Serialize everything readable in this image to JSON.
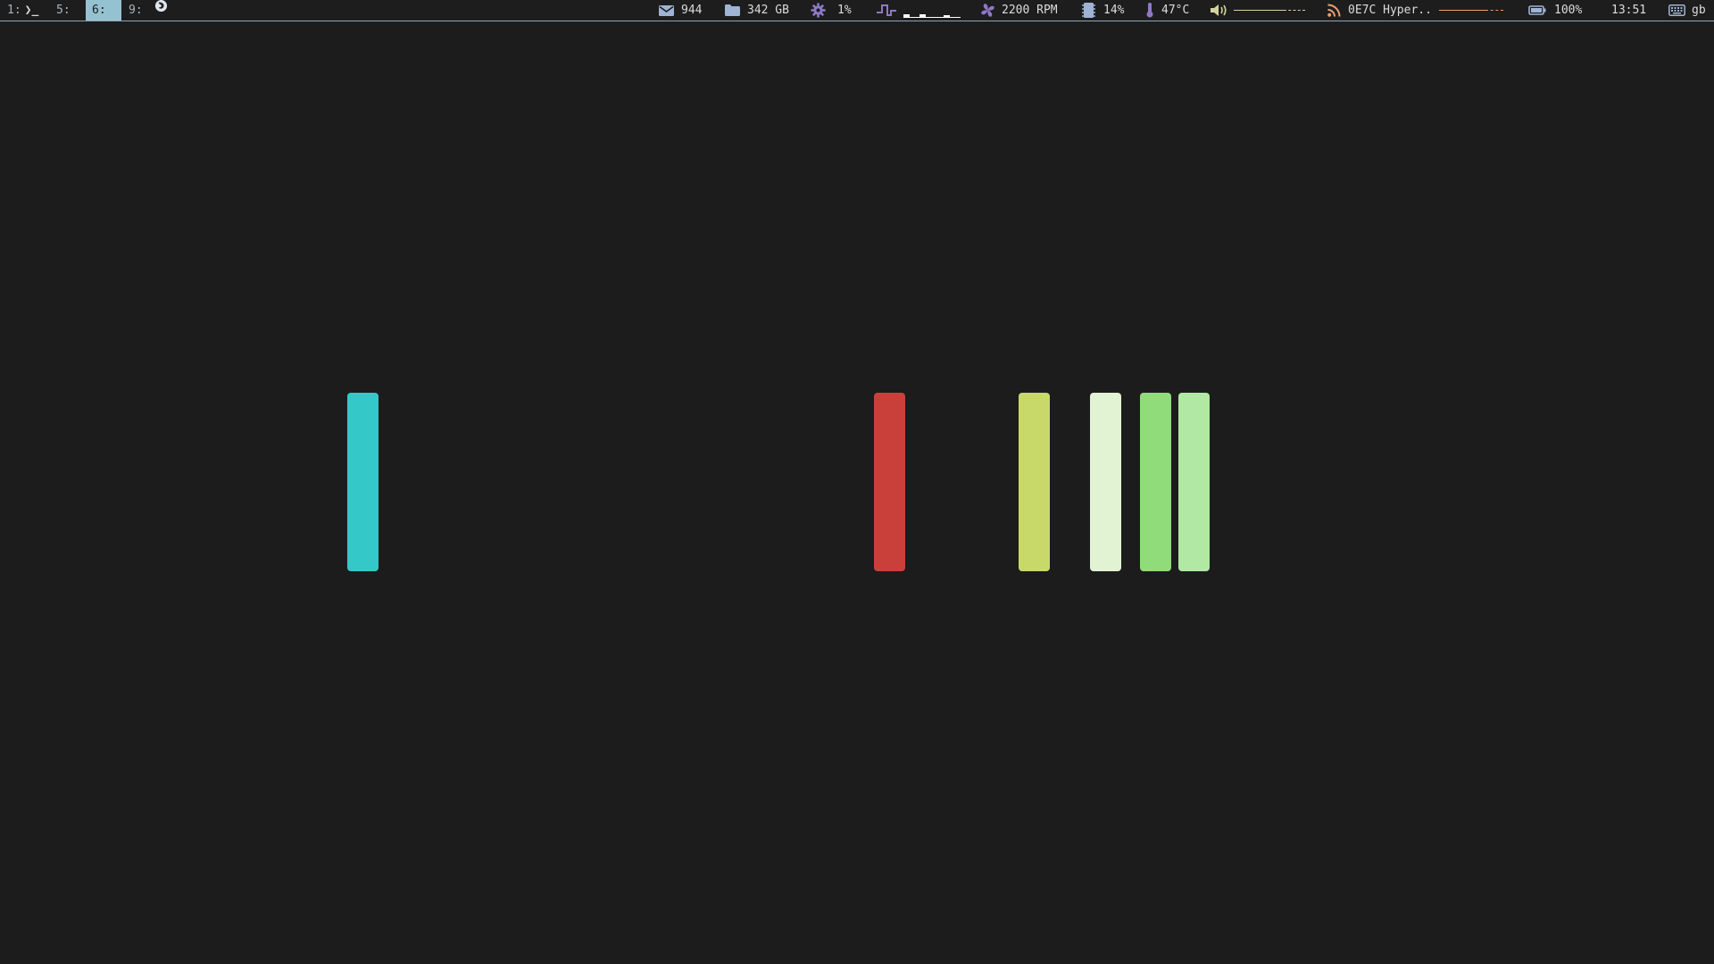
{
  "workspaces": [
    {
      "label": "1:",
      "icon": "terminal-icon",
      "icon_glyph": "❯_",
      "active": false
    },
    {
      "label": "5:",
      "active": false
    },
    {
      "label": "6:",
      "active": true
    },
    {
      "label": "9:",
      "icon": "browser-icon",
      "active": false
    }
  ],
  "status": {
    "mail": {
      "icon": "mail-icon",
      "value": "944"
    },
    "disk": {
      "icon": "folder-icon",
      "value": "342 GB"
    },
    "cpu": {
      "icon": "gear-icon",
      "value": "1%"
    },
    "network": {
      "icon": "network-activity-icon",
      "sparkline": [
        0.3,
        0.0,
        0.3,
        0.0,
        0.0,
        0.2,
        0.0
      ]
    },
    "fan": {
      "icon": "fan-icon",
      "value": "2200 RPM"
    },
    "memory": {
      "icon": "memory-icon",
      "value": "14%"
    },
    "temperature": {
      "icon": "thermometer-icon",
      "value": "47°C"
    },
    "volume": {
      "icon": "speaker-icon",
      "level": 0.7,
      "color": "#d5d2a0"
    },
    "rss": {
      "icon": "rss-icon",
      "value": "0E7C Hyper..",
      "level": 0.72,
      "color": "#e8a070"
    },
    "battery": {
      "icon": "battery-icon",
      "value": "100%"
    },
    "clock": {
      "value": "13:51"
    },
    "keyboard": {
      "icon": "keyboard-icon",
      "value": "gb"
    }
  },
  "windows": [
    {
      "name": "window-cyan",
      "color": "#34c8c8"
    },
    {
      "name": "window-red",
      "color": "#c9403a"
    },
    {
      "name": "window-yellow-green",
      "color": "#c8d96a"
    },
    {
      "name": "window-pale-green",
      "color": "#e1f3d2"
    },
    {
      "name": "window-green",
      "color": "#90dc7a"
    },
    {
      "name": "window-light-green",
      "color": "#b0e8a4"
    }
  ]
}
